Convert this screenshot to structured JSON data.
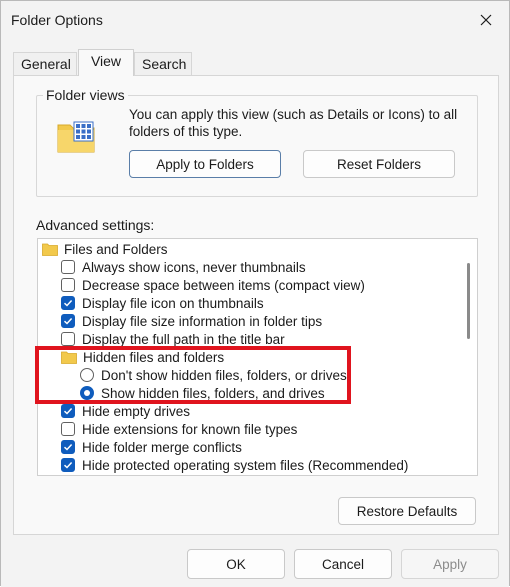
{
  "window": {
    "title": "Folder Options"
  },
  "tabs": [
    {
      "label": "General"
    },
    {
      "label": "View"
    },
    {
      "label": "Search"
    }
  ],
  "folder_views": {
    "label": "Folder views",
    "description": "You can apply this view (such as Details or Icons) to all folders of this type.",
    "apply_button": "Apply to Folders",
    "reset_button": "Reset Folders"
  },
  "advanced": {
    "label": "Advanced settings:",
    "items": [
      {
        "type": "folder",
        "label": "Files and Folders"
      },
      {
        "type": "checkbox",
        "checked": false,
        "label": "Always show icons, never thumbnails"
      },
      {
        "type": "checkbox",
        "checked": false,
        "label": "Decrease space between items (compact view)"
      },
      {
        "type": "checkbox",
        "checked": true,
        "label": "Display file icon on thumbnails"
      },
      {
        "type": "checkbox",
        "checked": true,
        "label": "Display file size information in folder tips"
      },
      {
        "type": "checkbox",
        "checked": false,
        "label": "Display the full path in the title bar"
      },
      {
        "type": "folder",
        "label": "Hidden files and folders"
      },
      {
        "type": "radio",
        "checked": false,
        "label": "Don't show hidden files, folders, or drives"
      },
      {
        "type": "radio",
        "checked": true,
        "label": "Show hidden files, folders, and drives"
      },
      {
        "type": "checkbox",
        "checked": true,
        "label": "Hide empty drives"
      },
      {
        "type": "checkbox",
        "checked": false,
        "label": "Hide extensions for known file types"
      },
      {
        "type": "checkbox",
        "checked": true,
        "label": "Hide folder merge conflicts"
      },
      {
        "type": "checkbox",
        "checked": true,
        "label": "Hide protected operating system files (Recommended)"
      }
    ],
    "restore_button": "Restore Defaults"
  },
  "footer": {
    "ok": "OK",
    "cancel": "Cancel",
    "apply": "Apply"
  },
  "colors": {
    "accent": "#0f5cbd",
    "highlight": "#e0141e",
    "folder": "#f2c94c"
  }
}
